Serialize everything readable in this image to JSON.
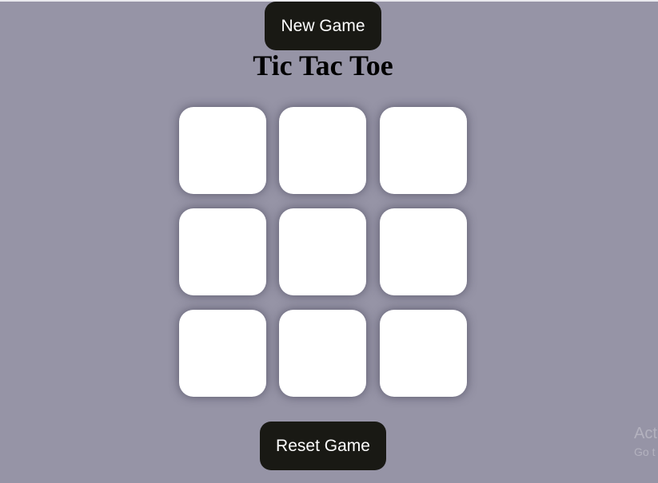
{
  "header": {
    "new_game_label": "New Game",
    "title": "Tic Tac Toe"
  },
  "board": {
    "cells": [
      "",
      "",
      "",
      "",
      "",
      "",
      "",
      "",
      ""
    ]
  },
  "footer": {
    "reset_game_label": "Reset Game"
  },
  "watermark": {
    "line1": "Act",
    "line2": "Go t"
  },
  "colors": {
    "background": "#9694a6",
    "button": "#191914",
    "button_text": "#ffffff",
    "cell": "#ffffff",
    "title": "#000000"
  }
}
